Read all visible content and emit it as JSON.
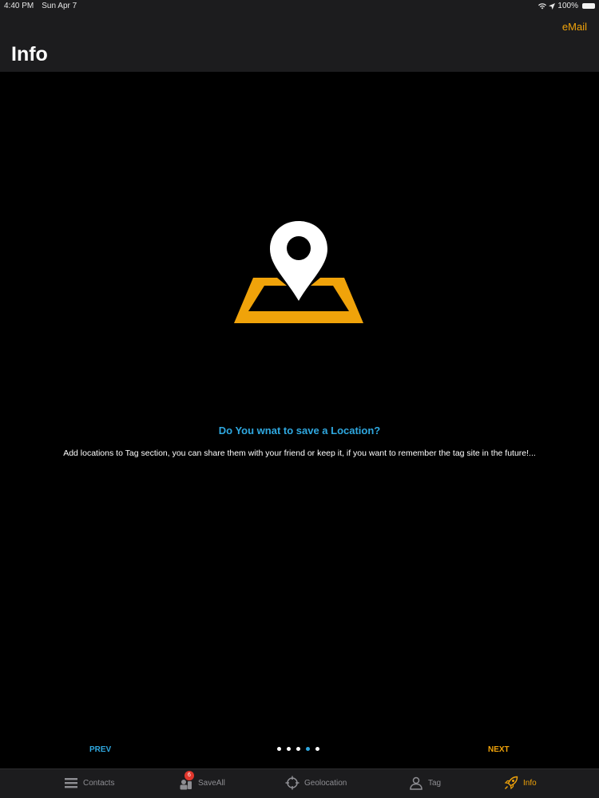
{
  "status_bar": {
    "time": "4:40 PM",
    "date": "Sun Apr 7",
    "battery": "100%"
  },
  "nav": {
    "title": "Info",
    "email_label": "eMail"
  },
  "content": {
    "title": "Do You wnat to save a Location?",
    "description": "Add locations to Tag section, you can share them with your friend or keep it, if you want to remember the tag site in the future!..."
  },
  "pager": {
    "prev_label": "PREV",
    "next_label": "NEXT",
    "total_pages": 5,
    "current_page": 4
  },
  "tabs": [
    {
      "label": "Contacts",
      "icon": "list-icon"
    },
    {
      "label": "SaveAll",
      "icon": "contacts-icon",
      "badge": "6"
    },
    {
      "label": "Geolocation",
      "icon": "crosshair-icon"
    },
    {
      "label": "Tag",
      "icon": "person-pin-icon"
    },
    {
      "label": "Info",
      "icon": "rocket-icon",
      "active": true
    }
  ],
  "colors": {
    "accent_orange": "#f0a30a",
    "accent_blue": "#2fa8e0",
    "background": "#000000",
    "bar_background": "#1c1c1e",
    "badge_red": "#e0362c"
  }
}
